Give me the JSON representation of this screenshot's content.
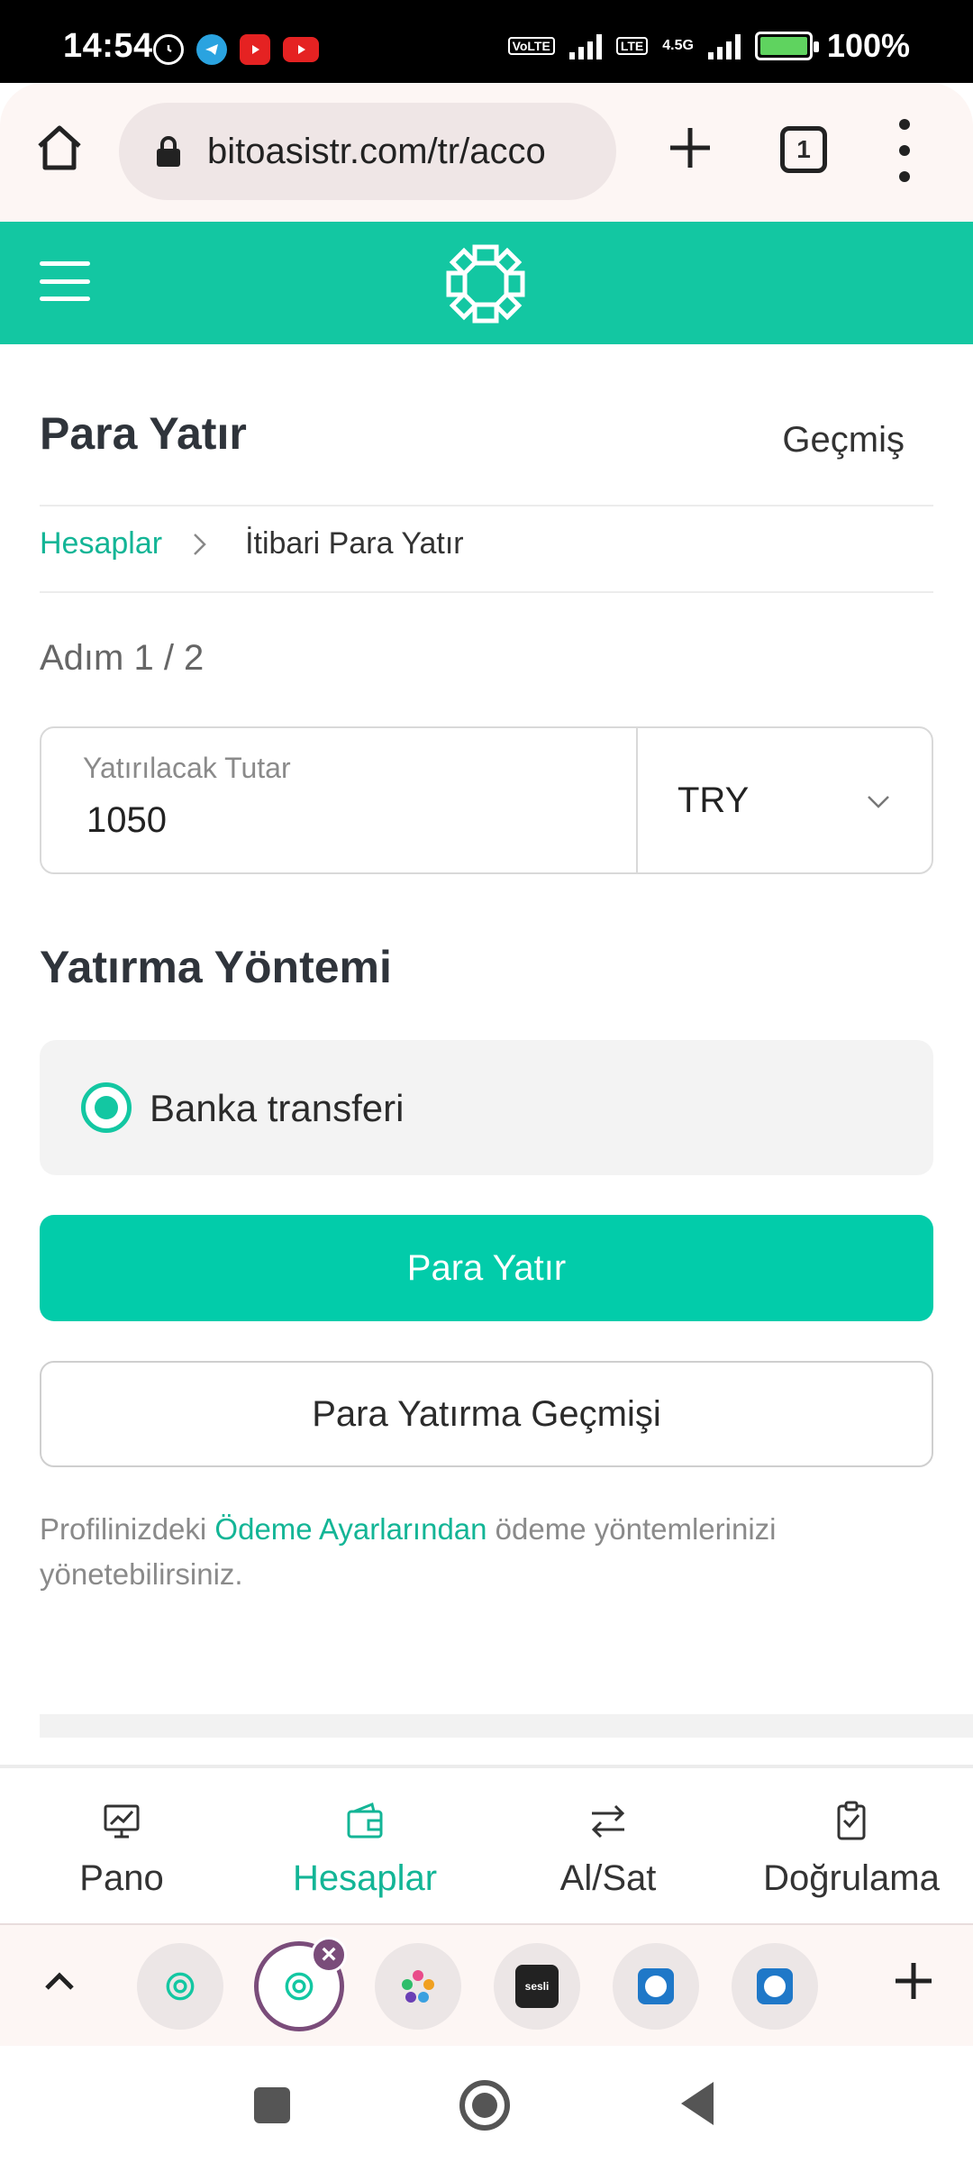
{
  "status_bar": {
    "time": "14:54",
    "battery": "100%",
    "network_1": "VoLTE",
    "network_2": "4.5G"
  },
  "browser": {
    "url": "bitoasistr.com/tr/acco",
    "tab_count": "1"
  },
  "header": {
    "logo_icon": "bitoasis-logo-icon",
    "menu_icon": "hamburger-menu-icon"
  },
  "page": {
    "title": "Para Yatır",
    "history_link": "Geçmiş",
    "breadcrumb": {
      "parent": "Hesaplar",
      "current": "İtibari Para Yatır"
    },
    "step": "Adım 1 / 2",
    "amount": {
      "label": "Yatırılacak Tutar",
      "value": "1050",
      "currency": "TRY"
    },
    "method_section_title": "Yatırma Yöntemi",
    "methods": [
      {
        "label": "Banka transferi",
        "selected": true
      }
    ],
    "submit_button": "Para Yatır",
    "history_button": "Para Yatırma Geçmişi",
    "note": {
      "prefix": "Profilinizdeki ",
      "link": "Ödeme Ayarlarından",
      "suffix": " ödeme yöntemlerinizi yönetebilirsiniz."
    }
  },
  "bottom_nav": {
    "items": [
      {
        "label": "Pano",
        "icon": "dashboard-icon",
        "active": false
      },
      {
        "label": "Hesaplar",
        "icon": "wallet-icon",
        "active": true
      },
      {
        "label": "Al/Sat",
        "icon": "swap-arrows-icon",
        "active": false
      },
      {
        "label": "Doğrulama",
        "icon": "clipboard-check-icon",
        "active": false
      }
    ]
  },
  "colors": {
    "brand": "#13c7a2",
    "button": "#02ccaa",
    "link": "#13b596",
    "tab_accent": "#7a4c7a"
  }
}
